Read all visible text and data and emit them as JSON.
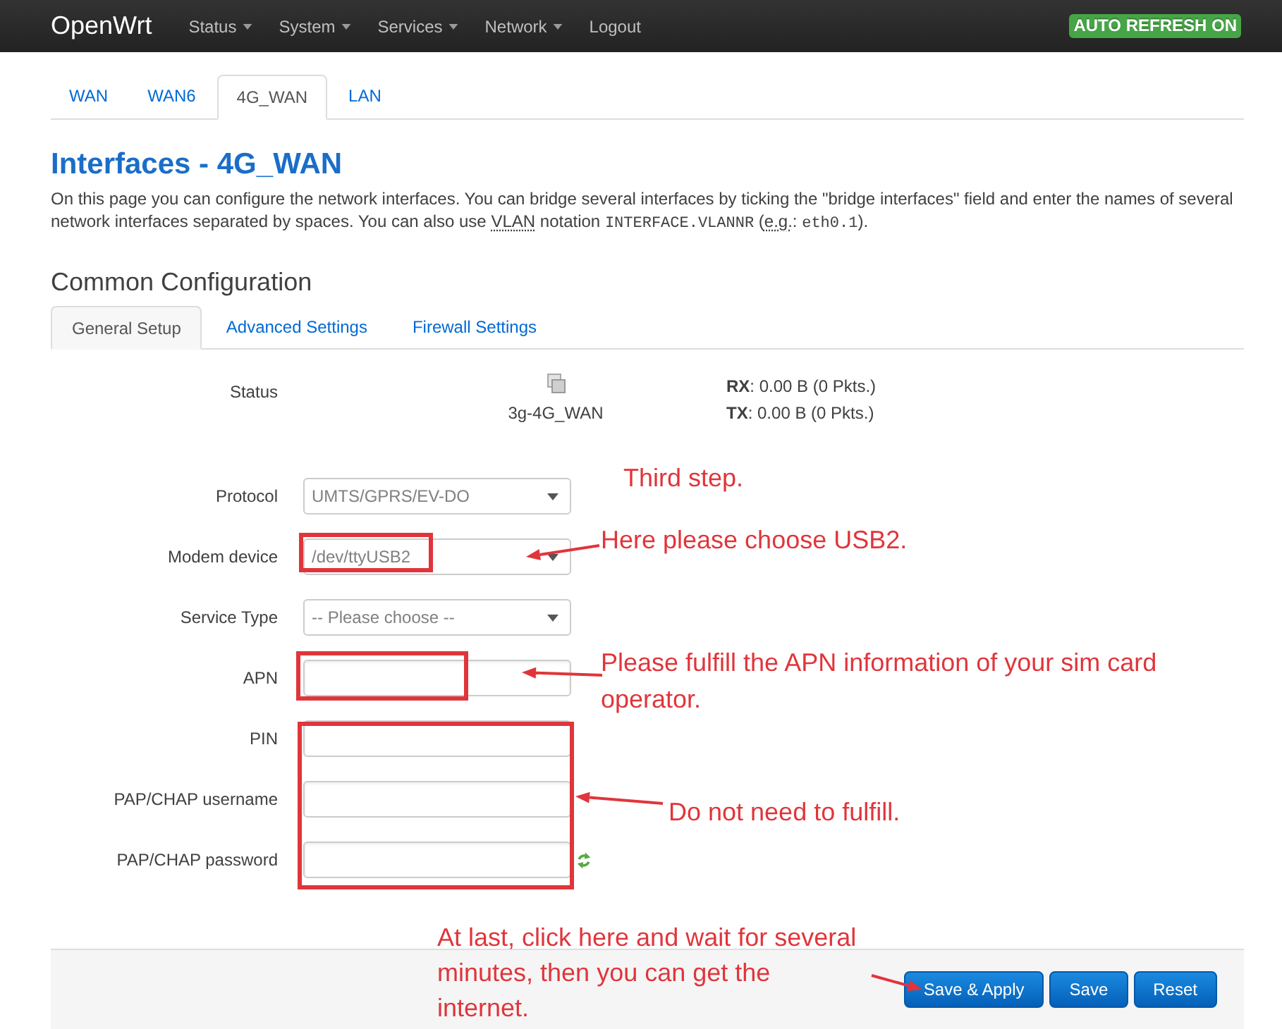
{
  "navbar": {
    "brand": "OpenWrt",
    "menu": [
      {
        "label": "Status",
        "dropdown": true
      },
      {
        "label": "System",
        "dropdown": true
      },
      {
        "label": "Services",
        "dropdown": true
      },
      {
        "label": "Network",
        "dropdown": true
      },
      {
        "label": "Logout",
        "dropdown": false
      }
    ],
    "badge": "AUTO REFRESH ON"
  },
  "interface_tabs": [
    {
      "label": "WAN",
      "selected": false
    },
    {
      "label": "WAN6",
      "selected": false
    },
    {
      "label": "4G_WAN",
      "selected": true
    },
    {
      "label": "LAN",
      "selected": false
    }
  ],
  "title": "Interfaces - 4G_WAN",
  "description": [
    {
      "kind": "text",
      "text": "On this page you can configure the network interfaces. You can bridge several interfaces by ticking the \"bridge interfaces\" field and enter the names of several network interfaces separated by spaces. You can also use "
    },
    {
      "kind": "abbr",
      "text": "VLAN"
    },
    {
      "kind": "text",
      "text": " notation "
    },
    {
      "kind": "code",
      "text": "INTERFACE.VLANNR"
    },
    {
      "kind": "text",
      "text": " ("
    },
    {
      "kind": "abbr",
      "text": "e.g."
    },
    {
      "kind": "text",
      "text": ": "
    },
    {
      "kind": "code",
      "text": "eth0.1"
    },
    {
      "kind": "text",
      "text": ")."
    }
  ],
  "section_title": "Common Configuration",
  "section_tabs": [
    {
      "label": "General Setup",
      "selected": true
    },
    {
      "label": "Advanced Settings",
      "selected": false
    },
    {
      "label": "Firewall Settings",
      "selected": false
    }
  ],
  "status": {
    "label": "Status",
    "device": "3g-4G_WAN",
    "rx": "**RX**: 0.00 B (0 Pkts.)",
    "tx": "**TX**: 0.00 B (0 Pkts.)"
  },
  "fields": [
    {
      "label": "Protocol",
      "kind": "select",
      "value": "UMTS/GPRS/EV-DO"
    },
    {
      "label": "Modem device",
      "kind": "select",
      "value": "/dev/ttyUSB2"
    },
    {
      "label": "Service Type",
      "kind": "select",
      "value": "-- Please choose --"
    },
    {
      "label": "APN",
      "kind": "text"
    },
    {
      "label": "PIN",
      "kind": "text"
    },
    {
      "label": "PAP/CHAP username",
      "kind": "text"
    },
    {
      "label": "PAP/CHAP password",
      "kind": "password"
    }
  ],
  "buttons": [
    "Save & Apply",
    "Save",
    "Reset"
  ],
  "annotations": [
    "Third step.",
    "Here please choose USB2.",
    "Please fulfill the APN information of your sim card operator.",
    "Do not need to fulfill.",
    "At last, click here and wait for several minutes, then you can get the internet."
  ]
}
